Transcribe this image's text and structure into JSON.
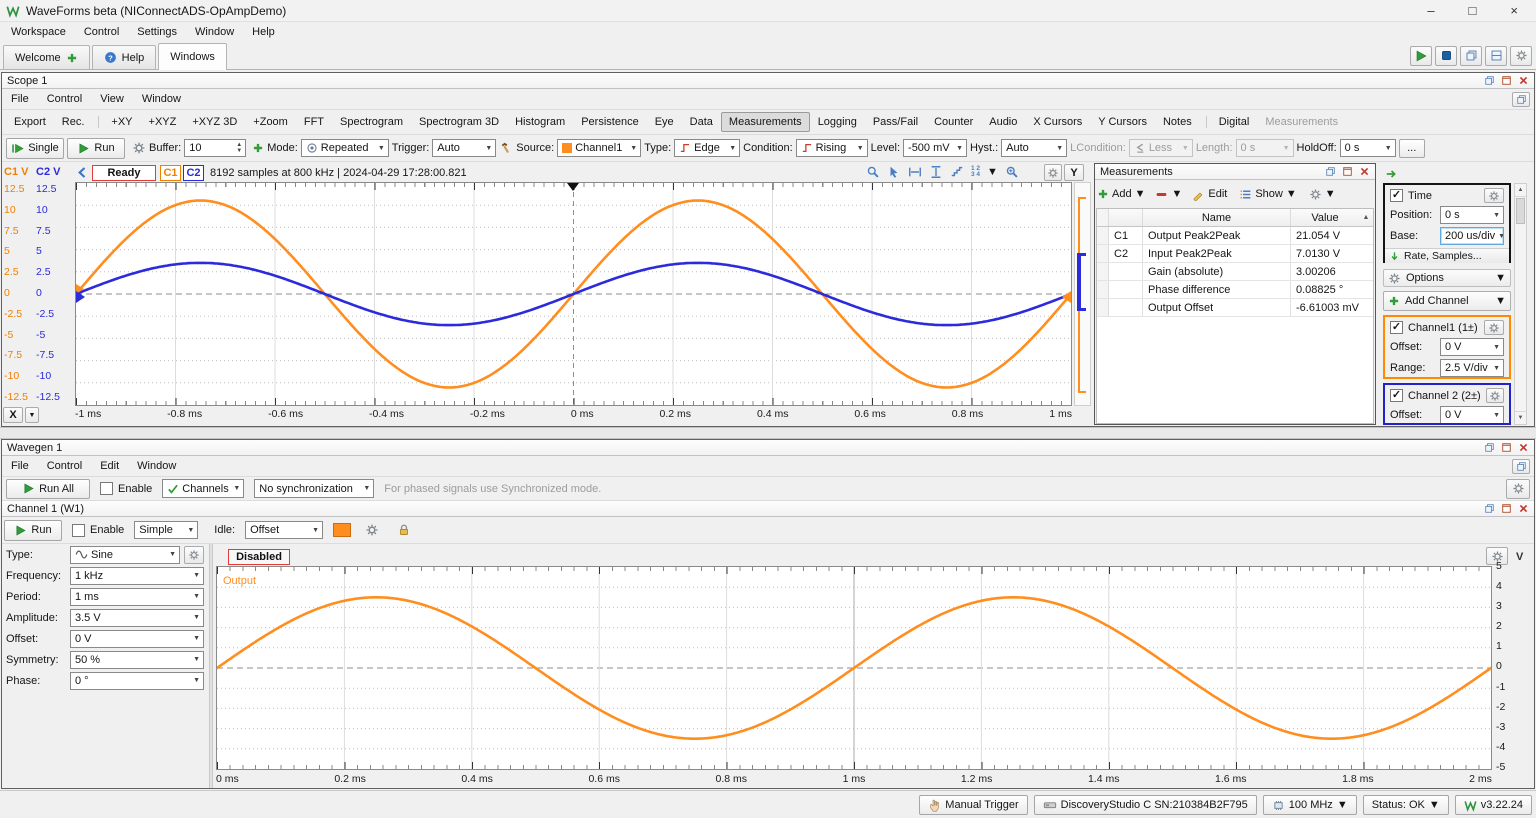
{
  "app": {
    "title": "WaveForms beta (NIConnectADS-OpAmpDemo)",
    "menu": [
      "Workspace",
      "Control",
      "Settings",
      "Window",
      "Help"
    ],
    "tabs": [
      {
        "label": "Welcome",
        "icon": "plus"
      },
      {
        "label": "Help",
        "icon": "help"
      },
      {
        "label": "Windows",
        "cls": "active"
      }
    ],
    "window_buttons": {
      "minimize": "–",
      "maximize": "□",
      "close": "×"
    }
  },
  "scope": {
    "title": "Scope 1",
    "menu": [
      "File",
      "Control",
      "View",
      "Window"
    ],
    "views": [
      {
        "label": "Export"
      },
      {
        "label": "Rec."
      },
      {
        "label": "+XY",
        "cls": "sep"
      },
      {
        "label": "+XYZ"
      },
      {
        "label": "+XYZ 3D"
      },
      {
        "label": "+Zoom"
      },
      {
        "label": "FFT"
      },
      {
        "label": "Spectrogram"
      },
      {
        "label": "Spectrogram 3D"
      },
      {
        "label": "Histogram"
      },
      {
        "label": "Persistence"
      },
      {
        "label": "Eye"
      },
      {
        "label": "Data"
      },
      {
        "label": "Measurements",
        "cls": "active"
      },
      {
        "label": "Logging"
      },
      {
        "label": "Pass/Fail"
      },
      {
        "label": "Counter"
      },
      {
        "label": "Audio"
      },
      {
        "label": "X Cursors"
      },
      {
        "label": "Y Cursors"
      },
      {
        "label": "Notes"
      },
      {
        "label": "Digital",
        "cls": "sep"
      },
      {
        "label": "Measurements",
        "cls": "disabled"
      }
    ],
    "controls": {
      "single": "Single",
      "run": "Run",
      "buffer_label": "Buffer:",
      "buffer_value": "10",
      "mode_label": "Mode:",
      "mode_value": "Repeated",
      "trigger_label": "Trigger:",
      "trigger_value": "Auto",
      "source_label": "Source:",
      "source_value": "Channel1",
      "type_label": "Type:",
      "type_value": "Edge",
      "condition_label": "Condition:",
      "condition_value": "Rising",
      "level_label": "Level:",
      "level_value": "-500 mV",
      "hyst_label": "Hyst.:",
      "hyst_value": "Auto",
      "lcondition_label": "LCondition:",
      "lcondition_value": "Less",
      "length_label": "Length:",
      "length_value": "0 s",
      "holdoff_label": "HoldOff:",
      "holdoff_value": "0 s",
      "more": "..."
    },
    "status": {
      "c1_axis": "C1 V",
      "c2_axis": "C2 V",
      "state": "Ready",
      "c1": "C1",
      "c2": "C2",
      "info": "8192 samples at 800 kHz  |  2024-04-29 17:28:00.821",
      "digits_top": "1 2",
      "digits_bottom": "3 4",
      "y_button": "Y",
      "x_button": "X"
    }
  },
  "measurements": {
    "title": "Measurements",
    "toolbar": {
      "add": "Add",
      "edit": "Edit",
      "show": "Show"
    },
    "columns": [
      "Name",
      "Value"
    ],
    "rows": [
      {
        "ch": "C1",
        "name": "Output Peak2Peak",
        "value": "21.054 V"
      },
      {
        "ch": "C2",
        "name": "Input Peak2Peak",
        "value": "7.0130 V"
      },
      {
        "ch": "",
        "name": "Gain (absolute)",
        "value": "3.00206"
      },
      {
        "ch": "",
        "name": "Phase difference",
        "value": "0.08825 °"
      },
      {
        "ch": "",
        "name": "Output Offset",
        "value": "-6.61003 mV"
      }
    ]
  },
  "time_panel": {
    "time": {
      "label": "Time",
      "position_label": "Position:",
      "position": "0 s",
      "base_label": "Base:",
      "base": "200 us/div",
      "rate": "Rate, Samples..."
    },
    "options": "Options",
    "add_channel": "Add Channel",
    "channel1": {
      "label": "Channel1 (1±)",
      "offset_label": "Offset:",
      "offset": "0 V",
      "range_label": "Range:",
      "range": "2.5 V/div"
    },
    "channel2": {
      "label": "Channel 2 (2±)",
      "offset_label": "Offset:",
      "offset": "0 V"
    }
  },
  "wavegen": {
    "title": "Wavegen 1",
    "menu": [
      "File",
      "Control",
      "Edit",
      "Window"
    ],
    "controls": {
      "run_all": "Run All",
      "enable": "Enable",
      "channels": "Channels",
      "sync": "No synchronization",
      "hint": "For phased signals use Synchronized mode."
    },
    "channel": {
      "title": "Channel 1 (W1)",
      "run": "Run",
      "enable": "Enable",
      "mode": "Simple",
      "idle_label": "Idle:",
      "idle": "Offset",
      "fields": [
        {
          "label": "Type:",
          "value": "Sine",
          "icon": "sine",
          "gear": true
        },
        {
          "label": "Frequency:",
          "value": "1 kHz"
        },
        {
          "label": "Period:",
          "value": "1 ms"
        },
        {
          "label": "Amplitude:",
          "value": "3.5 V"
        },
        {
          "label": "Offset:",
          "value": "0 V"
        },
        {
          "label": "Symmetry:",
          "value": "50 %"
        },
        {
          "label": "Phase:",
          "value": "0 °"
        }
      ],
      "plot": {
        "state": "Disabled",
        "series_label": "Output",
        "y_unit": "V"
      }
    }
  },
  "statusbar": {
    "manual_trigger": "Manual Trigger",
    "device": "DiscoveryStudio C SN:210384B2F795",
    "clock": "100 MHz",
    "status": "Status: OK",
    "version": "v3.22.24"
  },
  "chart_data": [
    {
      "id": "scope",
      "type": "line",
      "title": "Scope 1 capture",
      "x_unit": "ms",
      "x_range": [
        -1,
        1
      ],
      "x_ticks": [
        "-1 ms",
        "-0.8 ms",
        "-0.6 ms",
        "-0.4 ms",
        "-0.2 ms",
        "0 ms",
        "0.2 ms",
        "0.4 ms",
        "0.6 ms",
        "0.8 ms",
        "1 ms"
      ],
      "y_range": [
        -12.5,
        12.5
      ],
      "y_ticks": [
        "12.5",
        "10",
        "7.5",
        "5",
        "2.5",
        "0",
        "-2.5",
        "-5",
        "-7.5",
        "-10",
        "-12.5"
      ],
      "y_per_div_V": 2.5,
      "time_base": "200 us/div",
      "grid": true,
      "legend_position": "none",
      "trigger": {
        "position_ms": 0,
        "level_V": -0.5,
        "mode": "Auto",
        "condition": "Rising",
        "source": "Channel1"
      },
      "series": [
        {
          "name": "C1",
          "color": "#ff8e1f",
          "waveform": "sine",
          "amplitude_V": 10.527,
          "frequency_kHz": 1,
          "offset_V": 0,
          "phase_deg": 0,
          "peak2peak_V": 21.054
        },
        {
          "name": "C2",
          "color": "#2b2bdc",
          "waveform": "sine",
          "amplitude_V": 3.5065,
          "frequency_kHz": 1,
          "offset_V": 0,
          "phase_deg": 0,
          "peak2peak_V": 7.013
        }
      ]
    },
    {
      "id": "wavegen",
      "type": "line",
      "title": "Wavegen Channel 1 preview",
      "x_unit": "ms",
      "x_range": [
        0,
        2
      ],
      "x_ticks": [
        "0 ms",
        "0.2 ms",
        "0.4 ms",
        "0.6 ms",
        "0.8 ms",
        "1 ms",
        "1.2 ms",
        "1.4 ms",
        "1.6 ms",
        "1.8 ms",
        "2 ms"
      ],
      "y_range": [
        -5,
        5
      ],
      "y_ticks": [
        "5",
        "4",
        "3",
        "2",
        "1",
        "0",
        "-1",
        "-2",
        "-3",
        "-4",
        "-5"
      ],
      "grid": true,
      "legend_position": "top-left",
      "series": [
        {
          "name": "Output",
          "color": "#ff8e1f",
          "waveform": "sine",
          "amplitude_V": 3.5,
          "frequency_kHz": 1,
          "offset_V": 0,
          "phase_deg": 0
        }
      ]
    }
  ]
}
